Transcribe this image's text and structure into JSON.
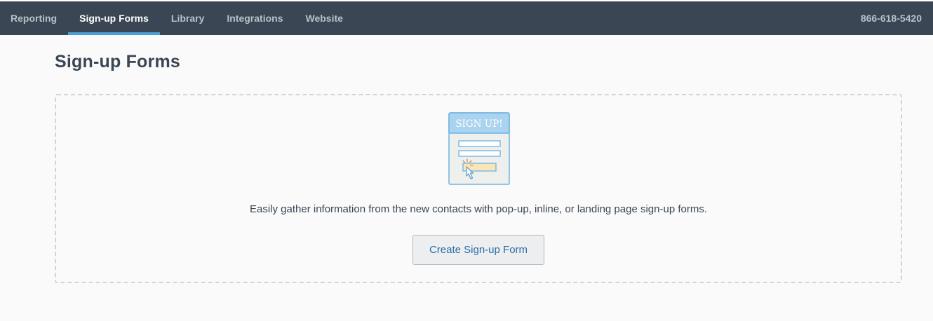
{
  "nav": {
    "tabs": [
      {
        "label": "Reporting",
        "active": false
      },
      {
        "label": "Sign-up Forms",
        "active": true
      },
      {
        "label": "Library",
        "active": false
      },
      {
        "label": "Integrations",
        "active": false
      },
      {
        "label": "Website",
        "active": false
      }
    ],
    "phone": "866-618-5420"
  },
  "page": {
    "title": "Sign-up Forms"
  },
  "empty_state": {
    "illustration_icon": "signup-form-illustration-icon",
    "illustration_text": "SIGN UP!",
    "description": "Easily gather information from the new contacts with pop-up, inline, or landing page sign-up forms.",
    "button_label": "Create Sign-up Form"
  },
  "colors": {
    "topbar": "#3b4654",
    "active_tab_indicator": "#4a9fd8",
    "button_text": "#2b6ea8"
  }
}
